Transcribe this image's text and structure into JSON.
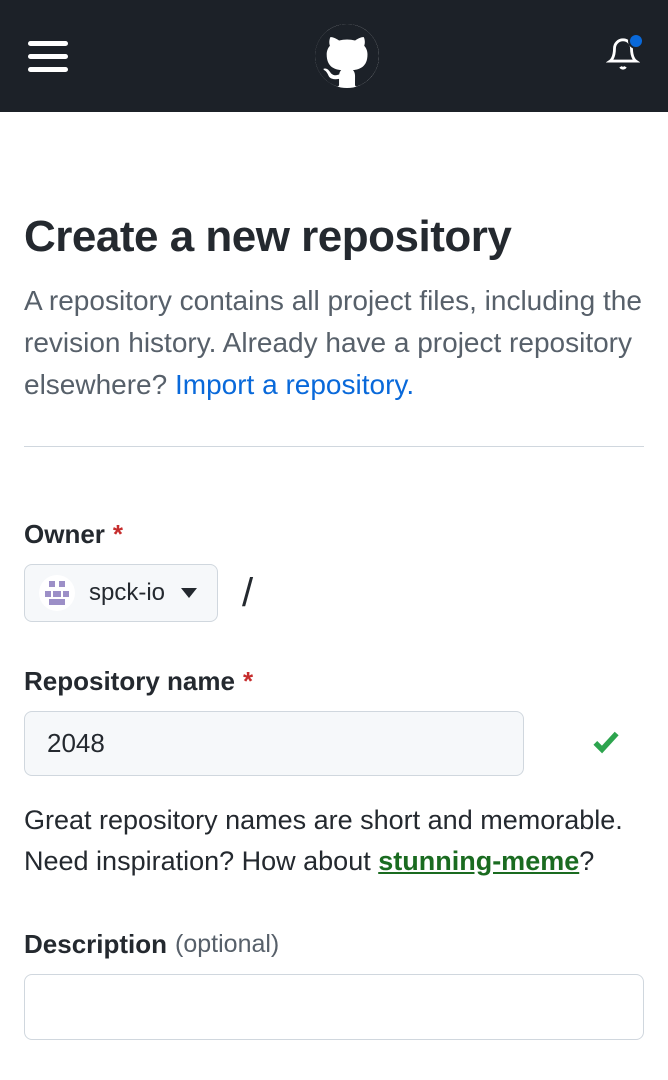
{
  "header": {
    "notification_has_dot": true
  },
  "page": {
    "title": "Create a new repository",
    "subtitle_prefix": "A repository contains all project files, including the revision history. Already have a project repository elsewhere? ",
    "import_link": "Import a repository."
  },
  "form": {
    "owner": {
      "label": "Owner",
      "required_marker": "*",
      "selected": "spck-io",
      "separator": "/"
    },
    "repo_name": {
      "label": "Repository name",
      "required_marker": "*",
      "value": "2048",
      "is_valid": true
    },
    "name_hint": {
      "prefix": "Great repository names are short and memorable. Need inspiration? How about ",
      "suggestion": "stunning-meme",
      "suffix": "?"
    },
    "description": {
      "label": "Description",
      "optional_marker": "(optional)",
      "value": ""
    }
  }
}
